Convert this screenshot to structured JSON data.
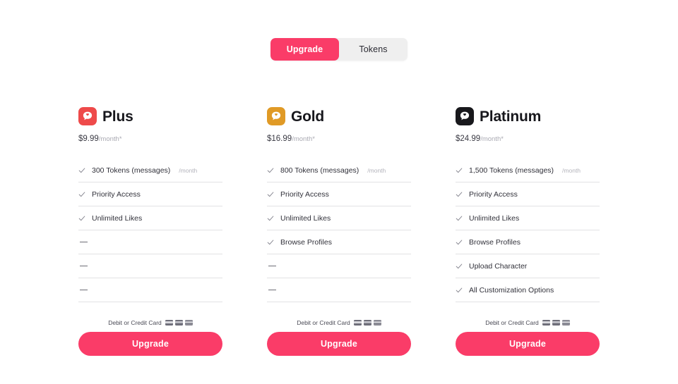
{
  "toggle": {
    "tabs": [
      {
        "label": "Upgrade",
        "active": true
      },
      {
        "label": "Tokens",
        "active": false
      }
    ]
  },
  "colors": {
    "accent": "#fa3c68",
    "plus_icon": "#ee4a4a",
    "gold_icon": "#e09a26",
    "platinum_icon": "#18181c",
    "divider": "#e2e2e4",
    "muted_text": "#b3b3bb"
  },
  "payment": {
    "label": "Debit or Credit Card",
    "card_icons": [
      "card-visa-icon",
      "card-mastercard-icon",
      "card-amex-icon"
    ]
  },
  "cta": {
    "label": "Upgrade"
  },
  "plans": [
    {
      "id": "plus",
      "name": "Plus",
      "icon": "speech-bubble-heart-icon",
      "icon_color": "#ee4a4a",
      "price": "$9.99",
      "period": "/month*",
      "features": [
        {
          "label": "300 Tokens (messages)",
          "sub": "/month",
          "included": true
        },
        {
          "label": "Priority Access",
          "sub": "",
          "included": true
        },
        {
          "label": "Unlimited Likes",
          "sub": "",
          "included": true
        },
        {
          "label": "",
          "sub": "",
          "included": false
        },
        {
          "label": "",
          "sub": "",
          "included": false
        },
        {
          "label": "",
          "sub": "",
          "included": false
        }
      ]
    },
    {
      "id": "gold",
      "name": "Gold",
      "icon": "speech-bubble-heart-icon",
      "icon_color": "#e09a26",
      "price": "$16.99",
      "period": "/month*",
      "features": [
        {
          "label": "800 Tokens (messages)",
          "sub": "/month",
          "included": true
        },
        {
          "label": "Priority Access",
          "sub": "",
          "included": true
        },
        {
          "label": "Unlimited Likes",
          "sub": "",
          "included": true
        },
        {
          "label": "Browse Profiles",
          "sub": "",
          "included": true
        },
        {
          "label": "",
          "sub": "",
          "included": false
        },
        {
          "label": "",
          "sub": "",
          "included": false
        }
      ]
    },
    {
      "id": "platinum",
      "name": "Platinum",
      "icon": "speech-bubble-heart-icon",
      "icon_color": "#18181c",
      "price": "$24.99",
      "period": "/month*",
      "features": [
        {
          "label": "1,500 Tokens (messages)",
          "sub": "/month",
          "included": true
        },
        {
          "label": "Priority Access",
          "sub": "",
          "included": true
        },
        {
          "label": "Unlimited Likes",
          "sub": "",
          "included": true
        },
        {
          "label": "Browse Profiles",
          "sub": "",
          "included": true
        },
        {
          "label": "Upload Character",
          "sub": "",
          "included": true
        },
        {
          "label": "All Customization Options",
          "sub": "",
          "included": true
        }
      ]
    }
  ]
}
